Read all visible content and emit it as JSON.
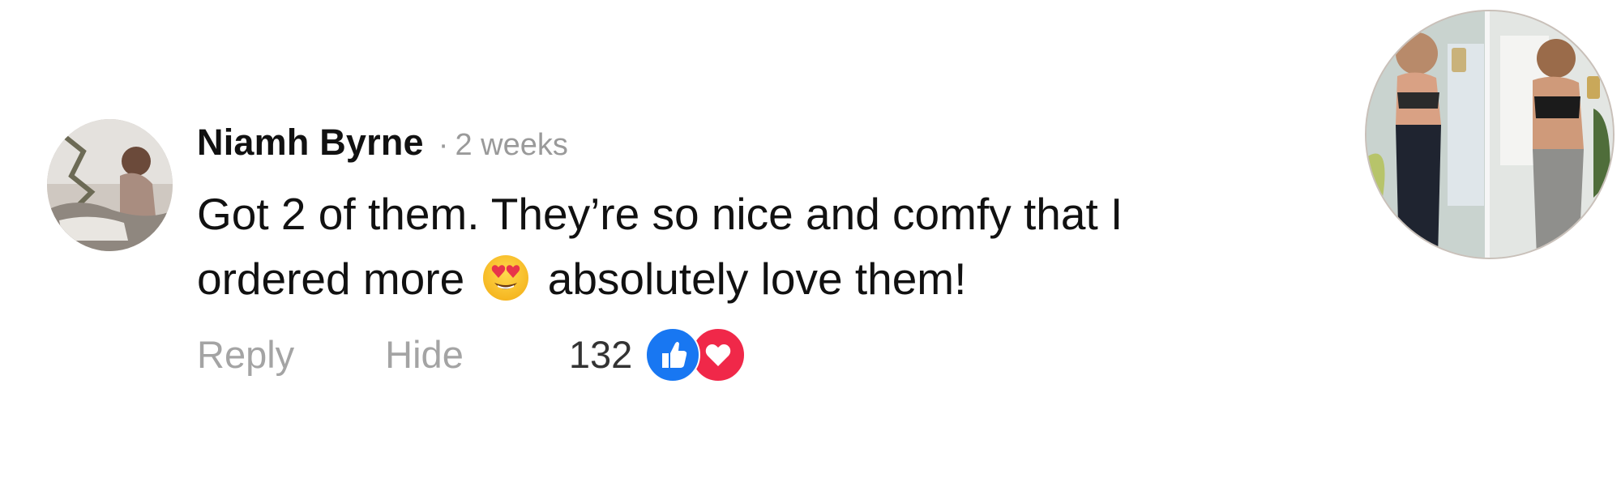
{
  "comment": {
    "author": "Niamh Byrne",
    "separator": "·",
    "timestamp": "2 weeks",
    "text_part1": "Got 2 of them. They’re so nice and comfy that I ordered more",
    "emoji": "heart-eyes-emoji",
    "text_part2": "absolutely love them!"
  },
  "actions": {
    "reply_label": "Reply",
    "hide_label": "Hide",
    "reaction_count": "132",
    "reactions": [
      "like-icon",
      "love-icon"
    ]
  },
  "colors": {
    "like": "#1877f2",
    "love": "#f02849",
    "muted_text": "#a4a4a4",
    "author_text": "#111111"
  }
}
